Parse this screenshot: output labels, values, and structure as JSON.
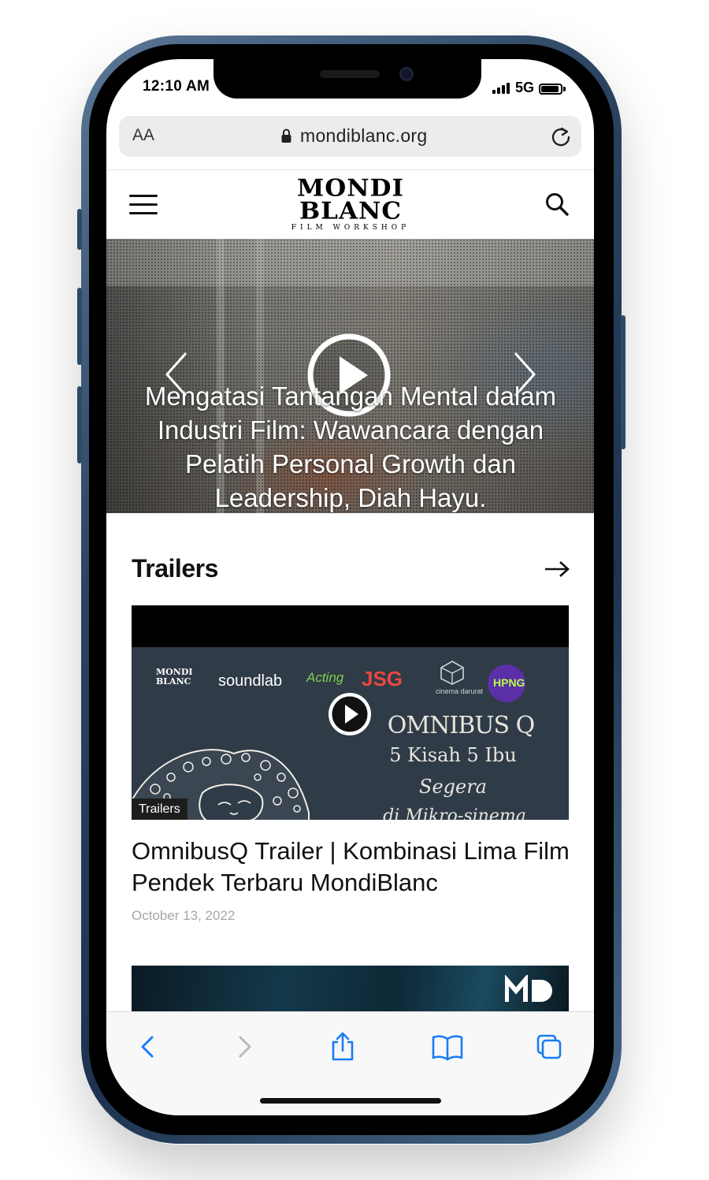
{
  "status_bar": {
    "time": "12:10 AM",
    "network": "5G"
  },
  "browser": {
    "text_size_label": "AA",
    "url": "mondiblanc.org"
  },
  "site": {
    "logo": {
      "line1": "MONDI",
      "line2": "BLANC",
      "tagline": "FILM WORKSHOP"
    }
  },
  "hero": {
    "title": "Mengatasi Tantangan Mental dalam Industri Film: Wawancara dengan Pelatih Personal Growth dan Leadership, Diah Hayu."
  },
  "trailers": {
    "heading": "Trailers",
    "cards": [
      {
        "category": "Trailers",
        "title": "OmnibusQ Trailer | Kombinasi Lima Film Pendek Terbaru MondiBlanc",
        "date": "October 13, 2022",
        "poster": {
          "partners": [
            "MONDI BLANC",
            "soundlab",
            "Acting",
            "JSG",
            "cinema darurat",
            "HPNG"
          ],
          "headline": "OMNIBUS Q",
          "subline": "5 Kisah 5 Ibu",
          "tagline": "Segera",
          "tagline2": "di Mikro-sinema"
        }
      }
    ]
  },
  "colors": {
    "safari_blue": "#1a7cf5",
    "text": "#111111",
    "date": "#a7a7a7"
  }
}
